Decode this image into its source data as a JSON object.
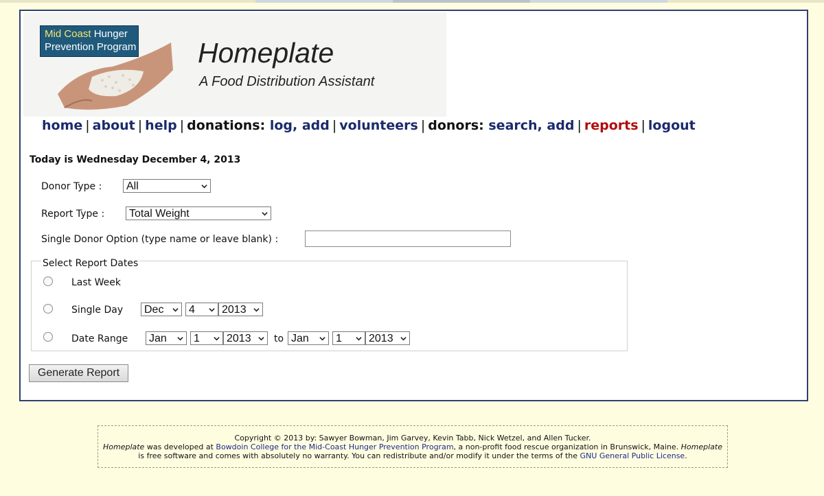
{
  "banner": {
    "logo_line1_a": "Mid Coast",
    "logo_line1_b": "Hunger",
    "logo_line2": "Prevention Program",
    "title": "Homeplate",
    "subtitle": "A Food Distribution Assistant"
  },
  "nav": {
    "home": "home",
    "about": "about",
    "help": "help",
    "donations_label": "donations:",
    "log": "log,",
    "add": "add",
    "volunteers": "volunteers",
    "donors_label": "donors:",
    "search": "search,",
    "add2": "add",
    "reports": "reports",
    "logout": "logout",
    "sep": "|"
  },
  "today": "Today is Wednesday December 4, 2013",
  "form": {
    "donor_type_label": "Donor Type :",
    "donor_type_value": "All",
    "report_type_label": "Report Type :",
    "report_type_value": "Total Weight",
    "single_donor_label": "Single Donor Option (type name or leave blank) :",
    "single_donor_value": "",
    "dates_legend": "Select Report Dates",
    "last_week": "Last Week",
    "single_day": "Single Day",
    "single_day_month": "Dec",
    "single_day_day": "4",
    "single_day_year": "2013",
    "date_range": "Date Range",
    "range_from_month": "Jan",
    "range_from_day": "1",
    "range_from_year": "2013",
    "to_label": "to",
    "range_to_month": "Jan",
    "range_to_day": "1",
    "range_to_year": "2013",
    "generate": "Generate Report"
  },
  "footer": {
    "line1": "Copyright © 2013 by: Sawyer Bowman, Jim Garvey, Kevin Tabb, Nick Wetzel, and Allen Tucker.",
    "homeplate": "Homeplate",
    "was_developed": " was developed at ",
    "bowdoin": "Bowdoin College",
    "for_the": " ",
    "mchpp_link": "for the Mid-Coast Hunger Prevention Program",
    "nonprofit": ", a non-profit food rescue organization in Brunswick, Maine. ",
    "homeplate2": "Homeplate",
    "line3": "is free software and comes with absolutely no warranty. You can redistribute and/or modify it under the terms of the ",
    "gpl": "GNU General Public License",
    "period": "."
  }
}
